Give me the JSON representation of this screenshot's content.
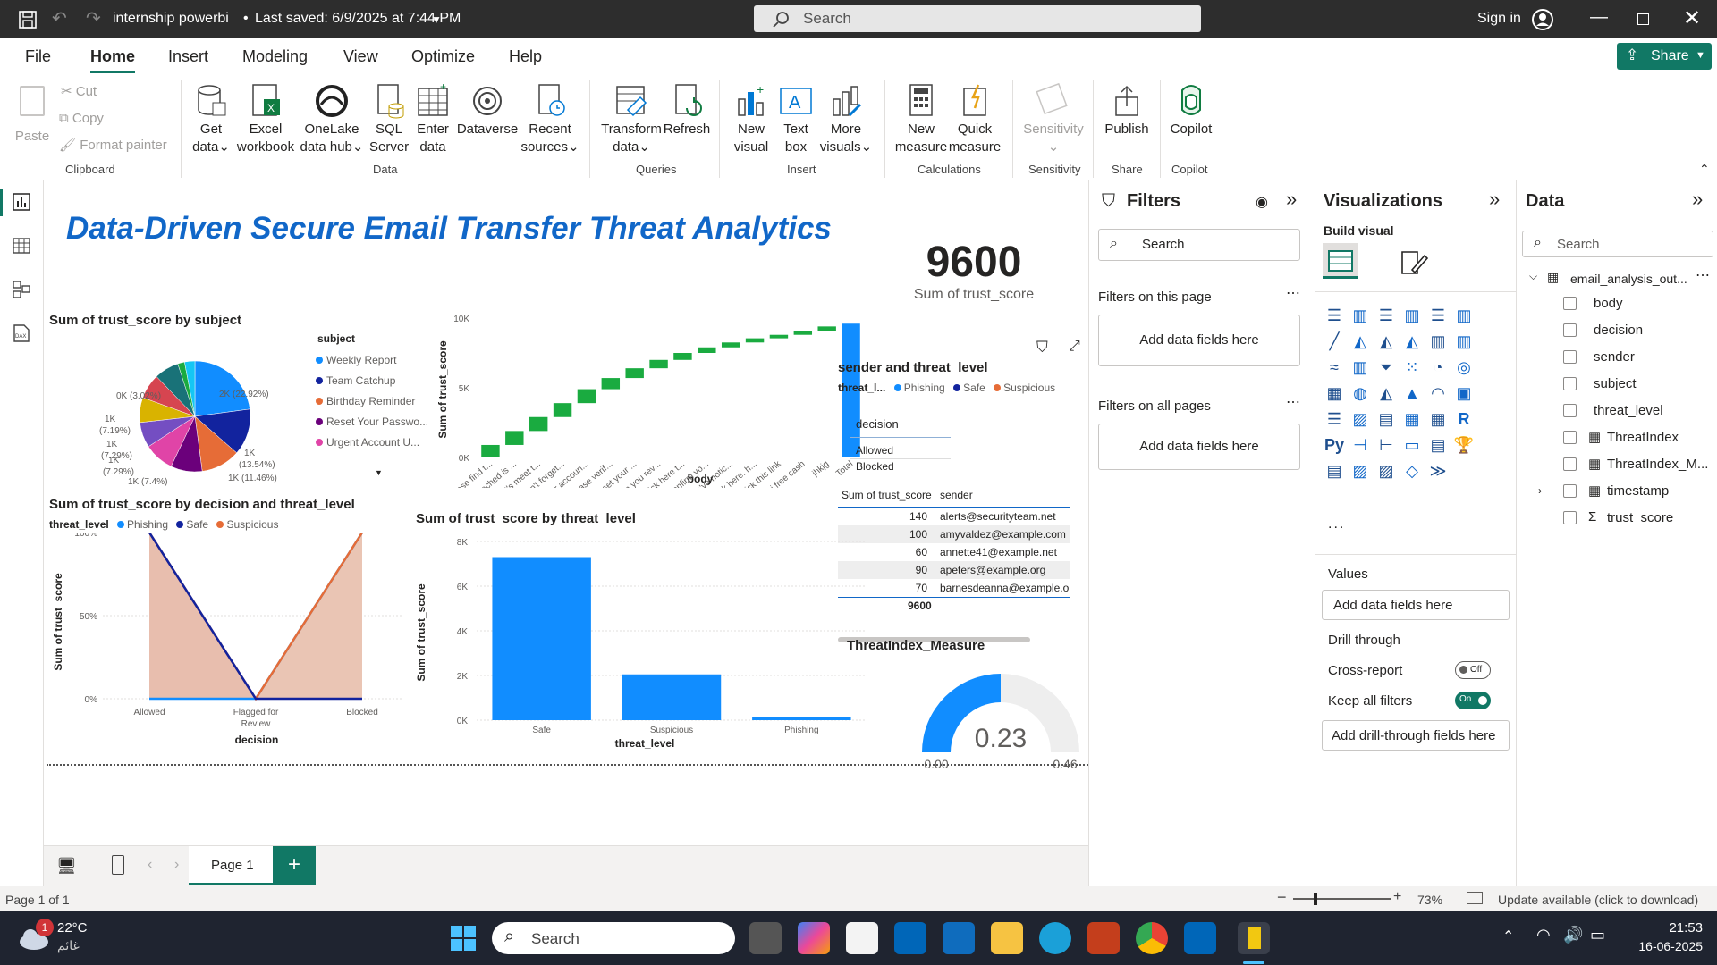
{
  "titlebar": {
    "doc": "internship powerbi",
    "saved": "Last saved: 6/9/2025 at 7:44 PM",
    "search": "Search",
    "signin": "Sign in"
  },
  "menu": {
    "file": "File",
    "home": "Home",
    "insert": "Insert",
    "modeling": "Modeling",
    "view": "View",
    "optimize": "Optimize",
    "help": "Help",
    "share": "Share"
  },
  "ribbon": {
    "paste": "Paste",
    "cut": "Cut",
    "copy": "Copy",
    "format_painter": "Format painter",
    "clipboard": "Clipboard",
    "get_data": [
      "Get",
      "data"
    ],
    "excel": [
      "Excel",
      "workbook"
    ],
    "onelake": [
      "OneLake",
      "data hub"
    ],
    "sql": [
      "SQL",
      "Server"
    ],
    "enter": [
      "Enter",
      "data"
    ],
    "dataverse": "Dataverse",
    "recent": [
      "Recent",
      "sources"
    ],
    "data": "Data",
    "transform": [
      "Transform",
      "data"
    ],
    "refresh": "Refresh",
    "queries": "Queries",
    "new_visual": [
      "New",
      "visual"
    ],
    "text_box": [
      "Text",
      "box"
    ],
    "more_visuals": [
      "More",
      "visuals"
    ],
    "insert": "Insert",
    "new_measure": [
      "New",
      "measure"
    ],
    "quick_measure": [
      "Quick",
      "measure"
    ],
    "calculations": "Calculations",
    "sensitivity": "Sensitivity",
    "sensitivity_grp": "Sensitivity",
    "publish": "Publish",
    "share": "Share",
    "copilot": "Copilot",
    "copilot_grp": "Copilot"
  },
  "report": {
    "title": "Data-Driven Secure Email Transfer Threat Analytics",
    "card_value": "9600",
    "card_label": "Sum of trust_score",
    "pie_title": "Sum of trust_score by subject",
    "pie_legend_title": "subject",
    "waterfall_ylabel": "Sum of trust_score",
    "waterfall_xlabel": "body",
    "area_title": "Sum of trust_score by decision and threat_level",
    "area_legend_title": "threat_level",
    "area_ylabel": "Sum of trust_score",
    "area_xlabel": "decision",
    "bar_title": "Sum of trust_score by threat_level",
    "bar_ylabel": "Sum of trust_score",
    "bar_xlabel": "threat_level",
    "matrix_title": "sender and threat_level",
    "matrix_legend_title": "threat_l...",
    "slicer_title": "decision",
    "slicer_items": [
      "Allowed",
      "Blocked"
    ],
    "table_headers": [
      "Sum of trust_score",
      "sender"
    ],
    "table_rows": [
      [
        "140",
        "alerts@securityteam.net"
      ],
      [
        "100",
        "amyvaldez@example.com"
      ],
      [
        "60",
        "annette41@example.net"
      ],
      [
        "90",
        "apeters@example.org"
      ],
      [
        "70",
        "barnesdeanna@example.o"
      ]
    ],
    "table_total": "9600",
    "gauge_title": "ThreatIndex_Measure",
    "gauge_value": "0.23",
    "gauge_min": "0.00",
    "gauge_max": "0.46"
  },
  "chart_data": [
    {
      "type": "pie",
      "title": "Sum of trust_score by subject",
      "legend": [
        "Weekly Report",
        "Team Catchup",
        "Birthday Reminder",
        "Reset Your Passwo...",
        "Urgent Account U..."
      ],
      "slices": [
        {
          "label": "2K (22.92%)",
          "value": 22.92,
          "color": "#118DFF"
        },
        {
          "label": "1K (13.54%)",
          "value": 13.54,
          "color": "#12239E"
        },
        {
          "label": "1K (11.46%)",
          "value": 11.46,
          "color": "#E66C37"
        },
        {
          "label": "",
          "value": 9.2,
          "color": "#6B007B"
        },
        {
          "label": "1K (8.75%)",
          "value": 8.75,
          "color": "#E044A7"
        },
        {
          "label": "1K (7.4%)",
          "value": 7.4,
          "color": "#744EC2"
        },
        {
          "label": "1K (7.29%)",
          "value": 7.29,
          "color": "#D9B300"
        },
        {
          "label": "1K (7.29%)",
          "value": 7.29,
          "color": "#D64550"
        },
        {
          "label": "1K (7.19%)",
          "value": 7.19,
          "color": "#197278"
        },
        {
          "label": "",
          "value": 2.0,
          "color": "#1AAB40"
        },
        {
          "label": "0K (3.02%)",
          "value": 3.02,
          "color": "#15C6F4"
        }
      ]
    },
    {
      "type": "waterfall",
      "categories": [
        "Please find t...",
        "Attached is ...",
        "Let's meet t...",
        "Don't forget...",
        "Your accoun...",
        "Please verif...",
        "Reset your ...",
        "Can you rev...",
        "Click here t...",
        "Confirm yo...",
        "We've notic...",
        "Click here. h...",
        "click this link",
        "hi free cash",
        "jhkjg",
        "Total"
      ],
      "cumulative": [
        900,
        1900,
        2900,
        3900,
        4900,
        5700,
        6400,
        7000,
        7500,
        7900,
        8250,
        8550,
        8800,
        9100,
        9400,
        9600
      ],
      "ylim": [
        0,
        10000
      ],
      "ticks": [
        "0K",
        "5K",
        "10K"
      ]
    },
    {
      "type": "area",
      "title": "Sum of trust_score by decision and threat_level",
      "categories": [
        "Allowed",
        "Flagged for Review",
        "Blocked"
      ],
      "series": [
        {
          "name": "Phishing",
          "values": [
            100,
            0,
            0
          ]
        },
        {
          "name": "Safe",
          "values": [
            0,
            0,
            100
          ]
        },
        {
          "name": "Suspicious",
          "values": [
            100,
            0,
            100
          ]
        }
      ],
      "ticks": [
        "0%",
        "50%",
        "100%"
      ],
      "colors": {
        "Phishing": "#12239E",
        "Safe": "#118DFF",
        "Suspicious": "#E66C37"
      }
    },
    {
      "type": "bar",
      "title": "Sum of trust_score by threat_level",
      "categories": [
        "Safe",
        "Suspicious",
        "Phishing"
      ],
      "values": [
        7300,
        2050,
        150
      ],
      "ylim": [
        0,
        8000
      ],
      "ticks": [
        "0K",
        "2K",
        "4K",
        "6K",
        "8K"
      ]
    },
    {
      "type": "gauge",
      "title": "ThreatIndex_Measure",
      "value": 0.23,
      "min": 0,
      "max": 0.46
    }
  ],
  "filters": {
    "title": "Filters",
    "search": "Search",
    "this_page": "Filters on this page",
    "add1": "Add data fields here",
    "all_pages": "Filters on all pages",
    "add2": "Add data fields here"
  },
  "viz": {
    "title": "Visualizations",
    "build": "Build visual",
    "values": "Values",
    "add_values": "Add data fields here",
    "drill": "Drill through",
    "cross": "Cross-report",
    "cross_state": "Off",
    "keep": "Keep all filters",
    "keep_state": "On",
    "add_drill": "Add drill-through fields here",
    "more": "..."
  },
  "data_pane": {
    "title": "Data",
    "search": "Search",
    "table": "email_analysis_out...",
    "fields": [
      "body",
      "decision",
      "sender",
      "subject",
      "threat_level",
      "ThreatIndex",
      "ThreatIndex_M...",
      "timestamp",
      "trust_score"
    ]
  },
  "pages": {
    "page1": "Page 1",
    "add": "+"
  },
  "status": {
    "page": "Page 1 of 1",
    "zoom": "73%",
    "update": "Update available (click to download)"
  },
  "taskbar": {
    "temp": "22°C",
    "weather": "غائم",
    "badge": "1",
    "search": "Search",
    "time": "21:53",
    "date": "16-06-2025"
  }
}
